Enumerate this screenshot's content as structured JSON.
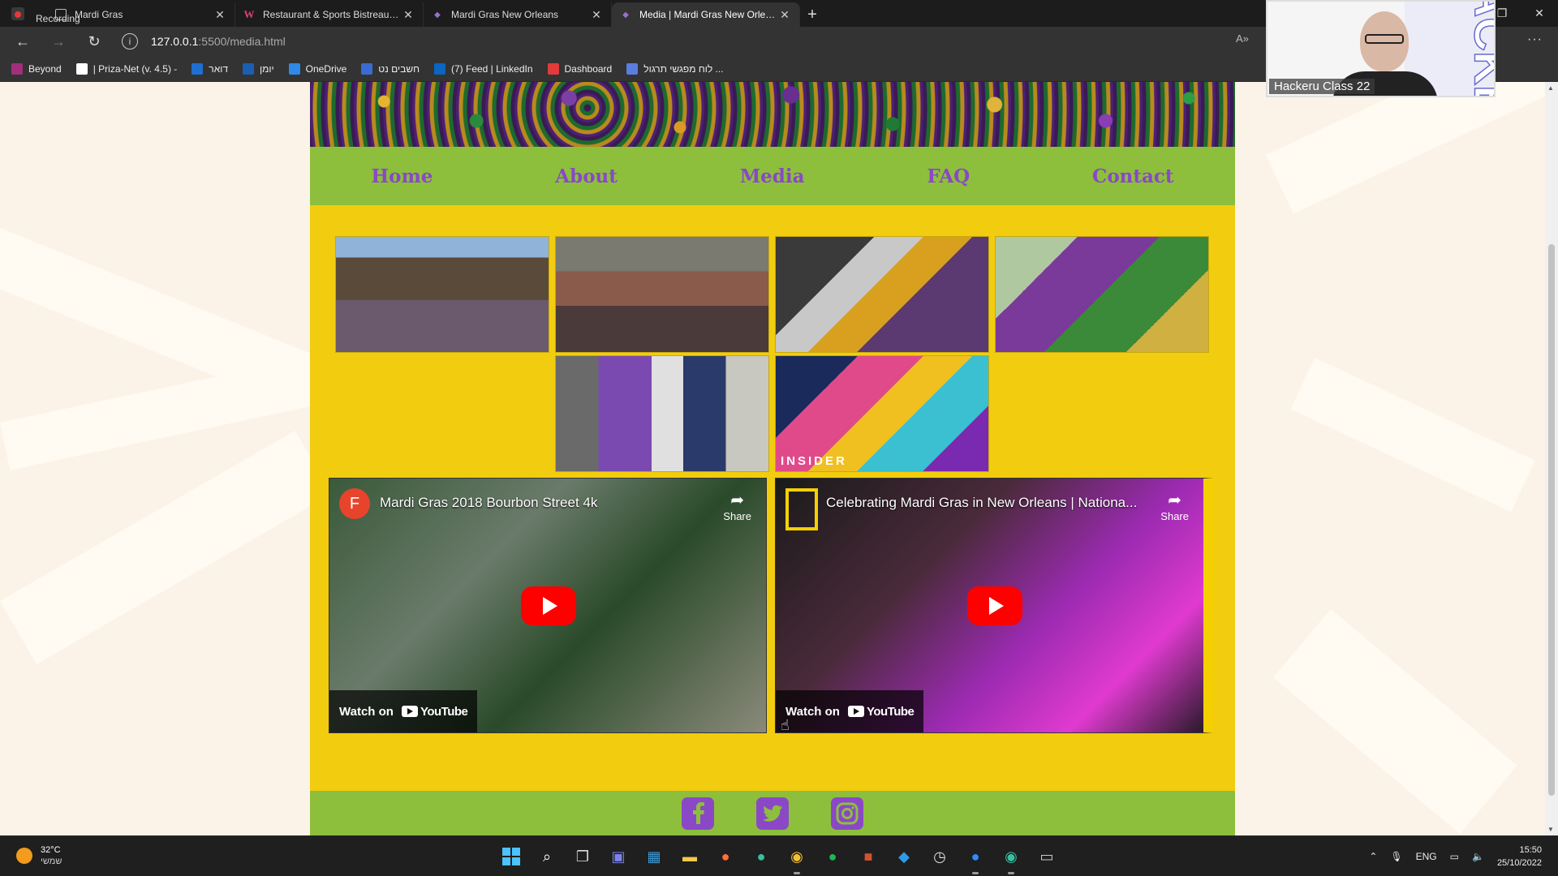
{
  "browser": {
    "recording_label": "Recording",
    "tabs": [
      {
        "title": "Mardi Gras",
        "icon": "document-icon",
        "active": false
      },
      {
        "title": "Restaurant & Sports Bistreaux | \\",
        "icon": "w-logo-icon",
        "active": false
      },
      {
        "title": "Mardi Gras New Orleans",
        "icon": "mask-icon",
        "active": false
      },
      {
        "title": "Media | Mardi Gras New Orleans",
        "icon": "mask-icon",
        "active": true
      }
    ],
    "url_host": "127.0.0.1",
    "url_path": ":5500/media.html",
    "bookmarks": [
      {
        "label": "Beyond",
        "color": "#a0307a"
      },
      {
        "label": "| Priza-Net (v. 4.5) -",
        "color": "#ffffff"
      },
      {
        "label": "דואר",
        "color": "#1f6fd1"
      },
      {
        "label": "יומן",
        "color": "#1a5fb4"
      },
      {
        "label": "OneDrive",
        "color": "#2e8ae6"
      },
      {
        "label": "חשבים נט",
        "color": "#3a6bd0"
      },
      {
        "label": "(7) Feed | LinkedIn",
        "color": "#0a66c2"
      },
      {
        "label": "Dashboard",
        "color": "#e23b3b"
      },
      {
        "label": "לוח מפגשי תרגול ...",
        "color": "#5a7de0"
      }
    ]
  },
  "site": {
    "nav": [
      "Home",
      "About",
      "Media",
      "FAQ",
      "Contact"
    ],
    "photo_caption": "INSIDER",
    "videos": [
      {
        "channel_initial": "F",
        "title": "Mardi Gras 2018 Bourbon Street 4k",
        "share": "Share",
        "watch_on": "Watch on",
        "platform": "YouTube"
      },
      {
        "channel_initial": "",
        "title": "Celebrating Mardi Gras in New Orleans | Nationa...",
        "share": "Share",
        "watch_on": "Watch on",
        "platform": "YouTube"
      }
    ],
    "social_icons": [
      "facebook-icon",
      "twitter-icon",
      "instagram-icon"
    ],
    "colors": {
      "nav_green": "#8dbf3d",
      "page_yellow": "#f2cc0f",
      "link_purple": "#8a48c7"
    }
  },
  "webcam": {
    "participant": "Hackeru Class 22"
  },
  "taskbar": {
    "temperature": "32°C",
    "weather_condition": "שמשי",
    "language": "ENG",
    "time": "15:50",
    "date": "25/10/2022"
  }
}
